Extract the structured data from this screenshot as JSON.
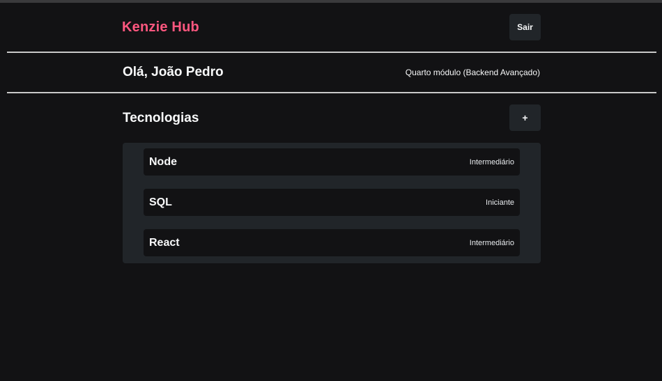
{
  "header": {
    "logo": "Kenzie Hub",
    "logout_label": "Sair"
  },
  "user": {
    "greeting": "Olá, João Pedro",
    "module": "Quarto módulo (Backend Avançado)"
  },
  "technologies": {
    "title": "Tecnologias",
    "add_label": "+",
    "items": [
      {
        "name": "Node",
        "level": "Intermediário"
      },
      {
        "name": "SQL",
        "level": "Iniciante"
      },
      {
        "name": "React",
        "level": "Intermediário"
      }
    ]
  },
  "colors": {
    "background": "#121214",
    "brand": "#ff577f",
    "card": "#212529",
    "text": "#f8f9fa"
  }
}
